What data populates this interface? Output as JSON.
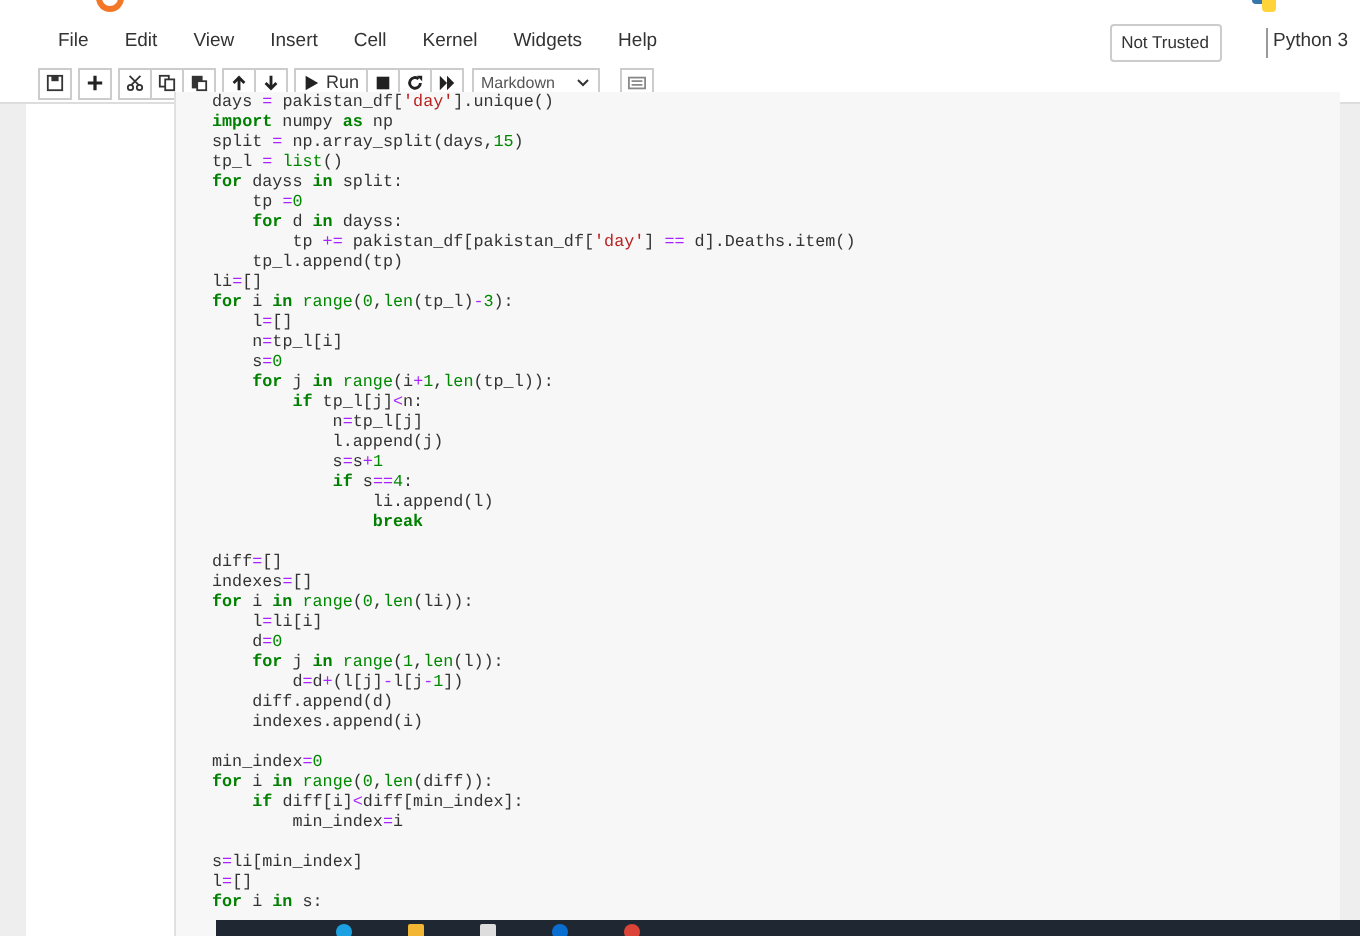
{
  "menu": [
    {
      "label": "File"
    },
    {
      "label": "Edit"
    },
    {
      "label": "View"
    },
    {
      "label": "Insert"
    },
    {
      "label": "Cell"
    },
    {
      "label": "Kernel"
    },
    {
      "label": "Widgets"
    },
    {
      "label": "Help"
    }
  ],
  "trust_button": "Not Trusted",
  "kernel_name": "Python 3",
  "toolbar": {
    "run_label": "Run",
    "cell_type": "Markdown"
  },
  "code_blocks": [
    [
      "days = pakistan_df['day'].unique()",
      "import numpy as np",
      "split = np.array_split(days,15)",
      "tp_l = list()",
      "for dayss in split:",
      "    tp =0",
      "    for d in dayss:",
      "        tp += pakistan_df[pakistan_df['day'] == d].Deaths.item()",
      "    tp_l.append(tp)",
      "li=[]",
      "for i in range(0,len(tp_l)-3):",
      "    l=[]",
      "    n=tp_l[i]",
      "    s=0",
      "    for j in range(i+1,len(tp_l)):",
      "        if tp_l[j]<n:",
      "            n=tp_l[j]",
      "            l.append(j)",
      "            s=s+1",
      "            if s==4:",
      "                li.append(l)",
      "                break"
    ],
    [
      "diff=[]",
      "indexes=[]",
      "for i in range(0,len(li)):",
      "    l=li[i]",
      "    d=0",
      "    for j in range(1,len(l)):",
      "        d=d+(l[j]-l[j-1])",
      "    diff.append(d)",
      "    indexes.append(i)"
    ],
    [
      "min_index=0",
      "for i in range(0,len(diff)):",
      "    if diff[i]<diff[min_index]:",
      "        min_index=i"
    ],
    [
      "s=li[min_index]",
      "l=[]",
      "for i in s:"
    ]
  ]
}
